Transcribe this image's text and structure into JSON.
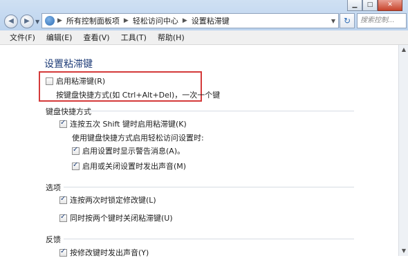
{
  "window": {
    "minimize_glyph": "▁",
    "maximize_glyph": "□",
    "close_glyph": "✕"
  },
  "nav": {
    "back_icon": "arrow-left",
    "forward_icon": "arrow-right",
    "breadcrumbs": [
      "所有控制面板项",
      "轻松访问中心",
      "设置粘滞键"
    ],
    "refresh_glyph": "↻",
    "search_placeholder": "搜索控制..."
  },
  "menu": [
    "文件(F)",
    "编辑(E)",
    "查看(V)",
    "工具(T)",
    "帮助(H)"
  ],
  "page": {
    "title": "设置粘滞键",
    "enable": {
      "label": "启用粘滞键(R)",
      "checked": false
    },
    "enable_desc": "按键盘快捷方式(如 Ctrl+Alt+Del)，一次一个键",
    "shortcut": {
      "heading": "键盘快捷方式",
      "turn_on": {
        "label": "连按五次 Shift 键时启用粘滞键(K)",
        "checked": true
      },
      "sub_heading": "使用键盘快捷方式启用轻松访问设置时:",
      "warning": {
        "label": "启用设置时显示警告消息(A)。",
        "checked": true
      },
      "sound": {
        "label": "启用或关闭设置时发出声音(M)",
        "checked": true
      }
    },
    "options": {
      "heading": "选项",
      "lock": {
        "label": "连按两次时锁定修改键(L)",
        "checked": true
      },
      "turn_off": {
        "label": "同时按两个键时关闭粘滞键(U)",
        "checked": true
      }
    },
    "feedback": {
      "heading": "反馈",
      "beep": {
        "label": "按修改键时发出声音(Y)",
        "checked": true
      }
    }
  }
}
